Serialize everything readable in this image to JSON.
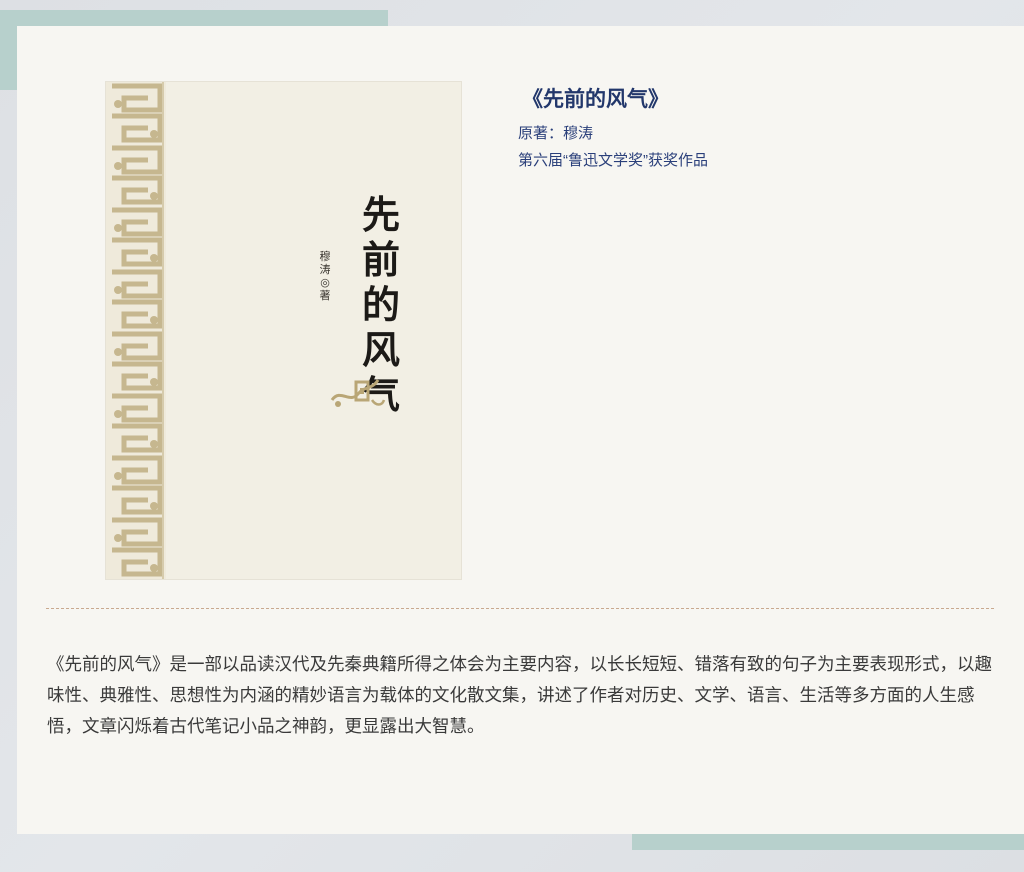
{
  "book": {
    "title": "《先前的风气》",
    "author_label": "原著：",
    "author_name": "穆涛",
    "award": "第六届“鲁迅文学奖”获奖作品"
  },
  "cover": {
    "title_chars": [
      "先",
      "前",
      "的",
      "风",
      "气"
    ],
    "author_text": "穆涛◎著"
  },
  "description": "《先前的风气》是一部以品读汉代及先秦典籍所得之体会为主要内容，以长长短短、错落有致的句子为主要表现形式，以趣味性、典雅性、思想性为内涵的精妙语言为载体的文化散文集，讲述了作者对历史、文学、语言、生活等多方面的人生感悟，文章闪烁着古代笔记小品之神韵，更显露出大智慧。",
  "colors": {
    "accent": "#b7d0cc",
    "title": "#22376b",
    "pattern": "#c9b994"
  },
  "icons": {
    "cover_pattern": "ornamental-meander-pattern",
    "cover_emblem": "dragon-emblem-icon"
  }
}
